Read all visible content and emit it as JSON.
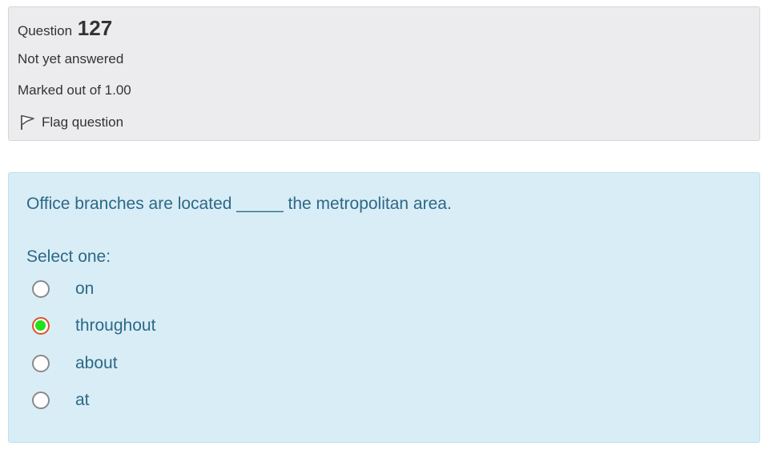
{
  "question_info": {
    "label": "Question",
    "number": "127",
    "state": "Not yet answered",
    "grade": "Marked out of 1.00",
    "flag_label": "Flag question"
  },
  "question": {
    "text": "Office branches are located _____ the metropolitan area.",
    "prompt": "Select one:",
    "options": [
      {
        "label": "on",
        "selected": false
      },
      {
        "label": "throughout",
        "selected": true
      },
      {
        "label": "about",
        "selected": false
      },
      {
        "label": "at",
        "selected": false
      }
    ]
  },
  "colors": {
    "info_background": "#ececee",
    "content_background": "#d9edf6",
    "content_text": "#2c6987",
    "selected_fill": "#22e01b",
    "selected_border": "#e2502a"
  }
}
